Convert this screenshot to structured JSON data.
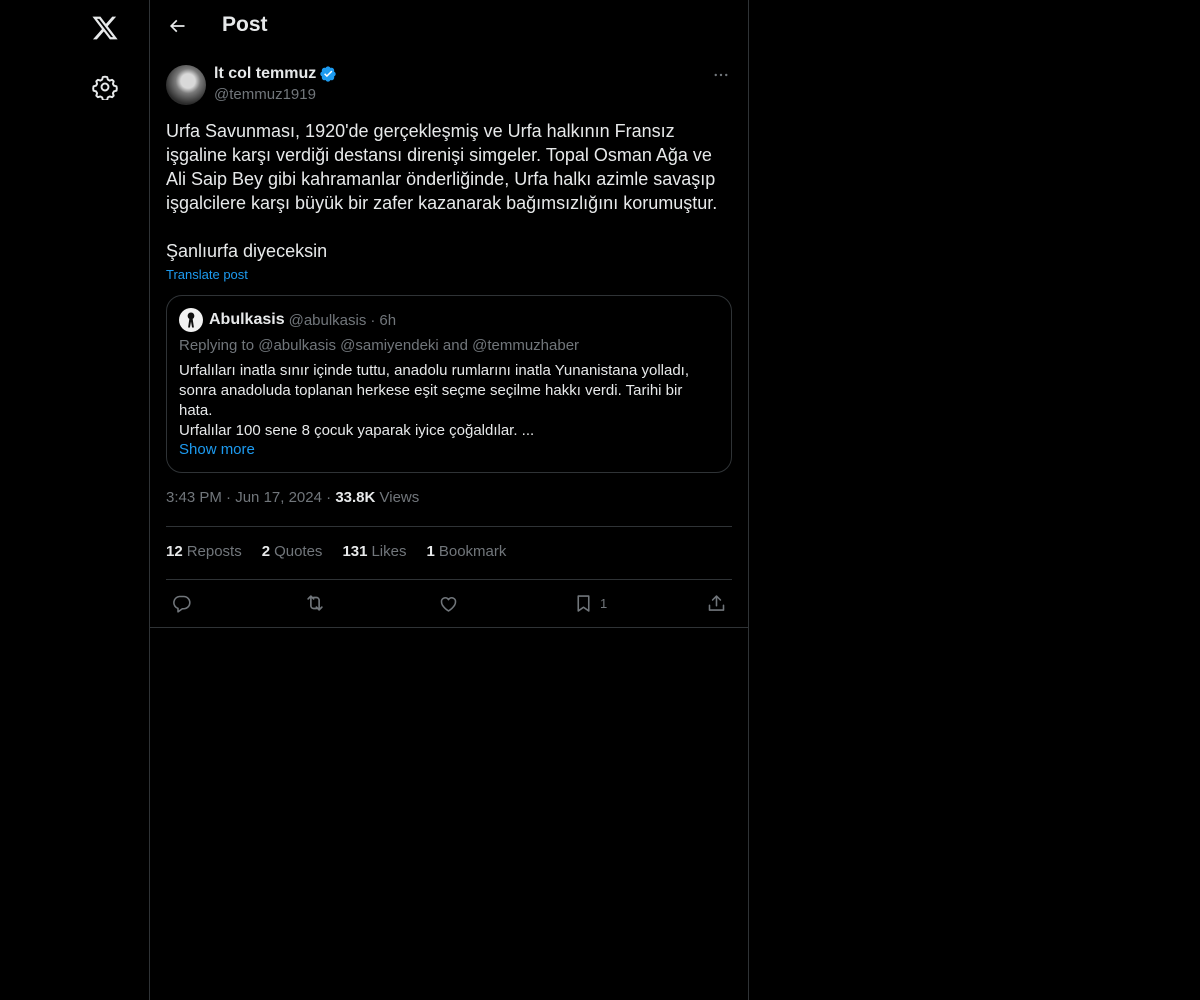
{
  "nav": {
    "logo_icon": "x-logo-icon",
    "settings_icon": "gear-icon"
  },
  "header": {
    "title": "Post",
    "back_icon": "arrow-left-icon"
  },
  "post": {
    "author_name": "lt col temmuz",
    "author_handle": "@temmuz1919",
    "verified": true,
    "text": "Urfa Savunması, 1920'de gerçekleşmiş ve Urfa halkının Fransız işgaline karşı verdiği destansı direnişi simgeler. Topal Osman Ağa ve Ali Saip Bey gibi kahramanlar önderliğinde, Urfa halkı azimle savaşıp işgalcilere karşı büyük bir zafer kazanarak bağımsızlığını korumuştur.\n\nŞanlıurfa diyeceksin",
    "translate_label": "Translate post",
    "time": "3:43 PM",
    "date": "Jun 17, 2024",
    "views_count": "33.8K",
    "views_label": "Views"
  },
  "quote": {
    "author_name": "Abulkasis",
    "author_handle": "@abulkasis",
    "separator": "·",
    "time": "6h",
    "replying_to": "Replying to @abulkasis @samiyendeki and @temmuzhaber",
    "text": "Urfalıları inatla sınır içinde tuttu, anadolu rumlarını inatla Yunanistana yolladı, sonra anadoluda toplanan herkese eşit seçme seçilme hakkı verdi. Tarihi bir hata.\nUrfalılar 100 sene 8 çocuk yaparak iyice çoğaldılar. ...",
    "show_more": "Show more"
  },
  "stats": [
    {
      "count": "12",
      "label": "Reposts"
    },
    {
      "count": "2",
      "label": "Quotes"
    },
    {
      "count": "131",
      "label": "Likes"
    },
    {
      "count": "1",
      "label": "Bookmark"
    }
  ],
  "actions": {
    "bookmark_count": "1"
  },
  "colors": {
    "background": "#000000",
    "text": "#e7e9ea",
    "secondary": "#71767b",
    "accent": "#1d9bf0",
    "border": "#2f3336"
  }
}
